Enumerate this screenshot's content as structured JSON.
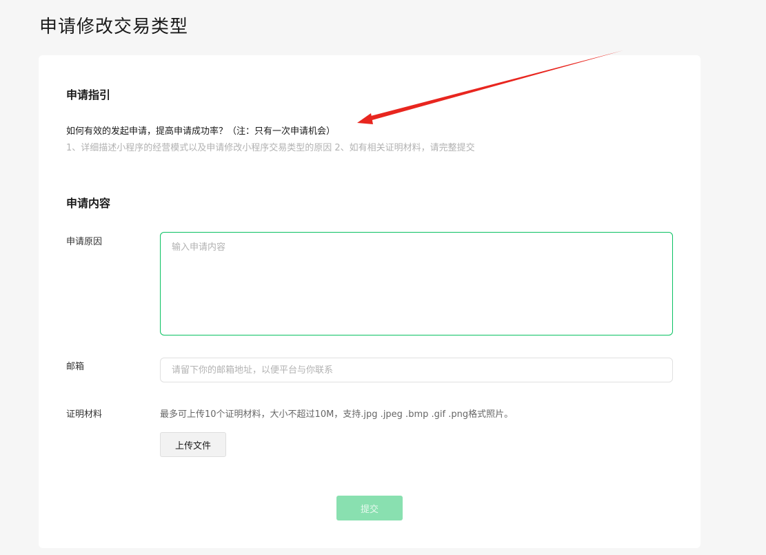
{
  "page": {
    "title": "申请修改交易类型"
  },
  "guide": {
    "section_title": "申请指引",
    "question": "如何有效的发起申请，提高申请成功率？（注：只有一次申请机会）",
    "tips": "1、详细描述小程序的经营模式以及申请修改小程序交易类型的原因 2、如有相关证明材料，请完整提交"
  },
  "content": {
    "section_title": "申请内容",
    "reason": {
      "label": "申请原因",
      "placeholder": "输入申请内容",
      "value": ""
    },
    "email": {
      "label": "邮箱",
      "placeholder": "请留下你的邮箱地址，以便平台与你联系",
      "value": ""
    },
    "proof": {
      "label": "证明材料",
      "hint": "最多可上传10个证明材料，大小不超过10M，支持.jpg .jpeg .bmp .gif .png格式照片。",
      "upload_label": "上传文件"
    },
    "submit_label": "提交"
  },
  "colors": {
    "accent": "#07c160",
    "submit_disabled": "#89e0b0",
    "annotation_arrow": "#e8261f"
  }
}
